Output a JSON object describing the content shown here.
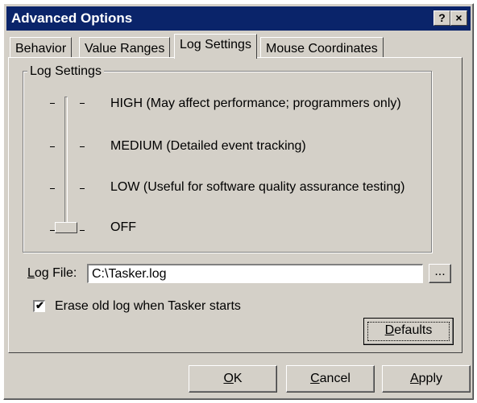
{
  "window": {
    "title": "Advanced Options",
    "help_glyph": "?",
    "close_glyph": "×"
  },
  "tabs": [
    {
      "label": "Behavior",
      "active": false
    },
    {
      "label": "Value Ranges",
      "active": false
    },
    {
      "label": "Log Settings",
      "active": true
    },
    {
      "label": "Mouse Coordinates",
      "active": false
    }
  ],
  "log_settings": {
    "group_label": "Log Settings",
    "levels": [
      "HIGH  (May affect performance; programmers only)",
      "MEDIUM  (Detailed event tracking)",
      "LOW  (Useful for software quality assurance testing)",
      "OFF"
    ],
    "selected_level": "OFF"
  },
  "log_file": {
    "label_accel": "L",
    "label_rest": "og File:",
    "value": "C:\\Tasker.log",
    "browse_label": "..."
  },
  "erase_option": {
    "label": "Erase old log when Tasker starts",
    "checked": true
  },
  "buttons": {
    "defaults_accel": "D",
    "defaults_rest": "efaults",
    "ok_accel": "O",
    "ok_rest": "K",
    "cancel_accel": "C",
    "cancel_rest": "ancel",
    "apply_accel": "A",
    "apply_rest": "pply"
  },
  "colors": {
    "titlebar": "#0a246a",
    "face": "#d4d0c8"
  }
}
